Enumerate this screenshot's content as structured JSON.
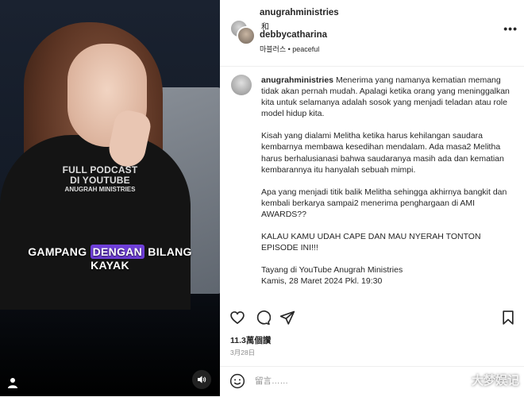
{
  "media": {
    "watermark": {
      "line1": "FULL PODCAST",
      "line2": "DI YOUTUBE",
      "line3": "ANUGRAH MINISTRIES"
    },
    "caption": {
      "before": "GAMPANG ",
      "highlight": "DENGAN",
      "after": " BILANG",
      "line2": "KAYAK"
    },
    "accent_highlight": "#6f3fd9",
    "icons": [
      "person-icon",
      "speaker-icon"
    ]
  },
  "header": {
    "user1": "anugrahministries",
    "and": "和",
    "user2": "debbycatharina",
    "audio": "마블러스 • peaceful",
    "more": "•••"
  },
  "comment": {
    "username": "anugrahministries",
    "paragraphs": [
      " Menerima yang namanya kematian memang tidak akan pernah mudah. Apalagi ketika orang yang meninggalkan kita untuk selamanya adalah sosok yang menjadi teladan atau role model hidup kita.",
      "Kisah yang dialami Melitha ketika harus kehilangan saudara kembarnya membawa kesedihan mendalam. Ada masa2 Melitha harus berhalusianasi bahwa saudaranya masih ada dan kematian kembarannya itu hanyalah sebuah mimpi.",
      "Apa yang menjadi titik balik Melitha sehingga akhirnya bangkit dan kembali berkarya sampai2 menerima penghargaan di AMI AWARDS??",
      "KALAU KAMU UDAH CAPE DAN MAU NYERAH TONTON EPISODE INI!!!",
      "Tayang di YouTube Anugrah Ministries",
      "Kamis, 28 Maret 2024 Pkl. 19:30"
    ]
  },
  "stats": {
    "likes": "11.3萬個讚",
    "date": "3月28日"
  },
  "add_comment": {
    "placeholder": "留言……"
  },
  "corner_watermark": "大梦娱记",
  "icons": [
    "heart-icon",
    "comment-icon",
    "share-icon",
    "bookmark-icon",
    "emoji-icon",
    "more-icon"
  ]
}
